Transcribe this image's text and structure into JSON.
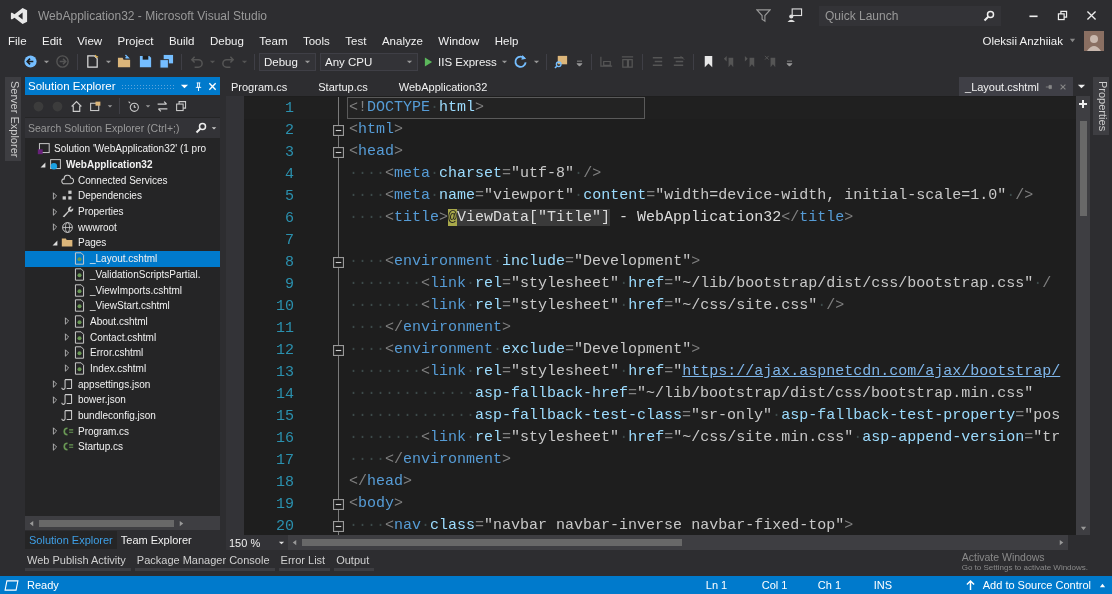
{
  "window": {
    "title": "WebApplication32 - Microsoft Visual Studio"
  },
  "quick_launch": {
    "placeholder": "Quick Launch"
  },
  "menu": [
    "File",
    "Edit",
    "View",
    "Project",
    "Build",
    "Debug",
    "Team",
    "Tools",
    "Test",
    "Analyze",
    "Window",
    "Help"
  ],
  "user": {
    "name": "Oleksii Anzhiiak"
  },
  "toolbar": {
    "configuration": "Debug",
    "platform": "Any CPU",
    "run": "IIS Express"
  },
  "side_tabs": {
    "left": "Server Explorer",
    "right": "Properties"
  },
  "solution_explorer": {
    "title": "Solution Explorer",
    "search": {
      "placeholder": "Search Solution Explorer (Ctrl+;)"
    },
    "tree": [
      {
        "label": "Solution 'WebApplication32' (1 pro",
        "kind": "solution",
        "selected": false,
        "children": [
          {
            "label": "WebApplication32",
            "kind": "project",
            "expanded": true,
            "selected": false,
            "children": [
              {
                "label": "Connected Services",
                "kind": "cloud",
                "selected": false
              },
              {
                "label": "Dependencies",
                "kind": "deps",
                "expanded": false,
                "selected": false
              },
              {
                "label": "Properties",
                "kind": "wrench",
                "expanded": false,
                "selected": false
              },
              {
                "label": "wwwroot",
                "kind": "globe",
                "expanded": false,
                "selected": false
              },
              {
                "label": "Pages",
                "kind": "folder",
                "expanded": true,
                "selected": false,
                "children": [
                  {
                    "label": "_Layout.cshtml",
                    "kind": "razor",
                    "selected": true
                  },
                  {
                    "label": "_ValidationScriptsPartial.",
                    "kind": "razor",
                    "selected": false
                  },
                  {
                    "label": "_ViewImports.cshtml",
                    "kind": "razor",
                    "selected": false
                  },
                  {
                    "label": "_ViewStart.cshtml",
                    "kind": "razor",
                    "selected": false
                  },
                  {
                    "label": "About.cshtml",
                    "kind": "razor",
                    "expanded": false,
                    "selected": false
                  },
                  {
                    "label": "Contact.cshtml",
                    "kind": "razor",
                    "expanded": false,
                    "selected": false
                  },
                  {
                    "label": "Error.cshtml",
                    "kind": "razor",
                    "expanded": false,
                    "selected": false
                  },
                  {
                    "label": "Index.cshtml",
                    "kind": "razor",
                    "expanded": false,
                    "selected": false
                  }
                ]
              },
              {
                "label": "appsettings.json",
                "kind": "json",
                "expanded": false,
                "selected": false
              },
              {
                "label": "bower.json",
                "kind": "json",
                "expanded": false,
                "selected": false
              },
              {
                "label": "bundleconfig.json",
                "kind": "json",
                "selected": false
              },
              {
                "label": "Program.cs",
                "kind": "cs",
                "expanded": false,
                "selected": false
              },
              {
                "label": "Startup.cs",
                "kind": "cs",
                "expanded": false,
                "selected": false
              }
            ]
          }
        ]
      }
    ],
    "tabs": [
      {
        "label": "Solution Explorer",
        "selected": true
      },
      {
        "label": "Team Explorer",
        "selected": false
      }
    ]
  },
  "editor": {
    "tabs": [
      {
        "label": "Program.cs",
        "selected": false
      },
      {
        "label": "Startup.cs",
        "selected": false
      },
      {
        "label": "WebApplication32",
        "selected": false
      },
      {
        "label": "_Layout.cshtml",
        "selected": true
      }
    ],
    "zoom": "150 %",
    "lines": [
      {
        "n": "1",
        "fold": false,
        "current": true,
        "tokens": [
          {
            "kind": "p",
            "text": "<!"
          },
          {
            "kind": "tag",
            "text": "DOCTYPE"
          },
          {
            "kind": "ws",
            "text": "·"
          },
          {
            "kind": "attr",
            "text": "html"
          },
          {
            "kind": "p",
            "text": ">"
          }
        ]
      },
      {
        "n": "2",
        "fold": true,
        "current": false,
        "tokens": [
          {
            "kind": "p",
            "text": "<"
          },
          {
            "kind": "tag",
            "text": "html"
          },
          {
            "kind": "p",
            "text": ">"
          }
        ]
      },
      {
        "n": "3",
        "fold": true,
        "current": false,
        "tokens": [
          {
            "kind": "p",
            "text": "<"
          },
          {
            "kind": "tag",
            "text": "head"
          },
          {
            "kind": "p",
            "text": ">"
          }
        ]
      },
      {
        "n": "4",
        "fold": false,
        "current": false,
        "tokens": [
          {
            "kind": "ws",
            "text": "····"
          },
          {
            "kind": "p",
            "text": "<"
          },
          {
            "kind": "tag",
            "text": "meta"
          },
          {
            "kind": "ws",
            "text": "·"
          },
          {
            "kind": "attr",
            "text": "charset"
          },
          {
            "kind": "p",
            "text": "="
          },
          {
            "kind": "str",
            "text": "\"utf-8\""
          },
          {
            "kind": "ws",
            "text": "·"
          },
          {
            "kind": "p",
            "text": "/>"
          }
        ]
      },
      {
        "n": "5",
        "fold": false,
        "current": false,
        "tokens": [
          {
            "kind": "ws",
            "text": "····"
          },
          {
            "kind": "p",
            "text": "<"
          },
          {
            "kind": "tag",
            "text": "meta"
          },
          {
            "kind": "ws",
            "text": "·"
          },
          {
            "kind": "attr",
            "text": "name"
          },
          {
            "kind": "p",
            "text": "="
          },
          {
            "kind": "str",
            "text": "\"viewport\""
          },
          {
            "kind": "ws",
            "text": "·"
          },
          {
            "kind": "attr",
            "text": "content"
          },
          {
            "kind": "p",
            "text": "="
          },
          {
            "kind": "str",
            "text": "\"width=device-width, initial-scale=1.0\""
          },
          {
            "kind": "ws",
            "text": "·"
          },
          {
            "kind": "p",
            "text": "/>"
          }
        ]
      },
      {
        "n": "6",
        "fold": false,
        "current": false,
        "tokens": [
          {
            "kind": "ws",
            "text": "····"
          },
          {
            "kind": "p",
            "text": "<"
          },
          {
            "kind": "tag",
            "text": "title"
          },
          {
            "kind": "p",
            "text": ">"
          },
          {
            "kind": "razor",
            "text": "@"
          },
          {
            "kind": "hl",
            "text": "ViewData[\"Title\"]"
          },
          {
            "kind": "text",
            "text": " - WebApplication32"
          },
          {
            "kind": "p",
            "text": "</"
          },
          {
            "kind": "tag",
            "text": "title"
          },
          {
            "kind": "p",
            "text": ">"
          }
        ]
      },
      {
        "n": "7",
        "fold": false,
        "current": false
      },
      {
        "n": "8",
        "fold": true,
        "current": false,
        "tokens": [
          {
            "kind": "ws",
            "text": "····"
          },
          {
            "kind": "p",
            "text": "<"
          },
          {
            "kind": "tag",
            "text": "environment"
          },
          {
            "kind": "ws",
            "text": "·"
          },
          {
            "kind": "attr",
            "text": "include"
          },
          {
            "kind": "p",
            "text": "="
          },
          {
            "kind": "str",
            "text": "\"Development\""
          },
          {
            "kind": "p",
            "text": ">"
          }
        ]
      },
      {
        "n": "9",
        "fold": false,
        "current": false,
        "tokens": [
          {
            "kind": "ws",
            "text": "········"
          },
          {
            "kind": "p",
            "text": "<"
          },
          {
            "kind": "tag",
            "text": "link"
          },
          {
            "kind": "ws",
            "text": "·"
          },
          {
            "kind": "attr",
            "text": "rel"
          },
          {
            "kind": "p",
            "text": "="
          },
          {
            "kind": "str",
            "text": "\"stylesheet\""
          },
          {
            "kind": "ws",
            "text": "·"
          },
          {
            "kind": "attr",
            "text": "href"
          },
          {
            "kind": "p",
            "text": "="
          },
          {
            "kind": "str",
            "text": "\"~/lib/bootstrap/dist/css/bootstrap.css\""
          },
          {
            "kind": "ws",
            "text": "·"
          },
          {
            "kind": "p",
            "text": "/"
          }
        ]
      },
      {
        "n": "10",
        "fold": false,
        "current": false,
        "tokens": [
          {
            "kind": "ws",
            "text": "········"
          },
          {
            "kind": "p",
            "text": "<"
          },
          {
            "kind": "tag",
            "text": "link"
          },
          {
            "kind": "ws",
            "text": "·"
          },
          {
            "kind": "attr",
            "text": "rel"
          },
          {
            "kind": "p",
            "text": "="
          },
          {
            "kind": "str",
            "text": "\"stylesheet\""
          },
          {
            "kind": "ws",
            "text": "·"
          },
          {
            "kind": "attr",
            "text": "href"
          },
          {
            "kind": "p",
            "text": "="
          },
          {
            "kind": "str",
            "text": "\"~/css/site.css\""
          },
          {
            "kind": "ws",
            "text": "·"
          },
          {
            "kind": "p",
            "text": "/>"
          }
        ]
      },
      {
        "n": "11",
        "fold": false,
        "current": false,
        "tokens": [
          {
            "kind": "ws",
            "text": "····"
          },
          {
            "kind": "p",
            "text": "</"
          },
          {
            "kind": "tag",
            "text": "environment"
          },
          {
            "kind": "p",
            "text": ">"
          }
        ]
      },
      {
        "n": "12",
        "fold": true,
        "current": false,
        "tokens": [
          {
            "kind": "ws",
            "text": "····"
          },
          {
            "kind": "p",
            "text": "<"
          },
          {
            "kind": "tag",
            "text": "environment"
          },
          {
            "kind": "ws",
            "text": "·"
          },
          {
            "kind": "attr",
            "text": "exclude"
          },
          {
            "kind": "p",
            "text": "="
          },
          {
            "kind": "str",
            "text": "\"Development\""
          },
          {
            "kind": "p",
            "text": ">"
          }
        ]
      },
      {
        "n": "13",
        "fold": false,
        "current": false,
        "tokens": [
          {
            "kind": "ws",
            "text": "········"
          },
          {
            "kind": "p",
            "text": "<"
          },
          {
            "kind": "tag",
            "text": "link"
          },
          {
            "kind": "ws",
            "text": "·"
          },
          {
            "kind": "attr",
            "text": "rel"
          },
          {
            "kind": "p",
            "text": "="
          },
          {
            "kind": "str",
            "text": "\"stylesheet\""
          },
          {
            "kind": "ws",
            "text": "·"
          },
          {
            "kind": "attr",
            "text": "href"
          },
          {
            "kind": "p",
            "text": "="
          },
          {
            "kind": "str",
            "text": "\""
          },
          {
            "kind": "link",
            "text": "https://ajax.aspnetcdn.com/ajax/bootstrap/"
          }
        ]
      },
      {
        "n": "14",
        "fold": false,
        "current": false,
        "tokens": [
          {
            "kind": "ws",
            "text": "··············"
          },
          {
            "kind": "attr",
            "text": "asp-fallback-href"
          },
          {
            "kind": "p",
            "text": "="
          },
          {
            "kind": "str",
            "text": "\"~/lib/bootstrap/dist/css/bootstrap.min.css\""
          }
        ]
      },
      {
        "n": "15",
        "fold": false,
        "current": false,
        "tokens": [
          {
            "kind": "ws",
            "text": "··············"
          },
          {
            "kind": "attr",
            "text": "asp-fallback-test-class"
          },
          {
            "kind": "p",
            "text": "="
          },
          {
            "kind": "str",
            "text": "\"sr-only\""
          },
          {
            "kind": "ws",
            "text": "·"
          },
          {
            "kind": "attr",
            "text": "asp-fallback-test-property"
          },
          {
            "kind": "p",
            "text": "="
          },
          {
            "kind": "str",
            "text": "\"pos"
          }
        ]
      },
      {
        "n": "16",
        "fold": false,
        "current": false,
        "tokens": [
          {
            "kind": "ws",
            "text": "········"
          },
          {
            "kind": "p",
            "text": "<"
          },
          {
            "kind": "tag",
            "text": "link"
          },
          {
            "kind": "ws",
            "text": "·"
          },
          {
            "kind": "attr",
            "text": "rel"
          },
          {
            "kind": "p",
            "text": "="
          },
          {
            "kind": "str",
            "text": "\"stylesheet\""
          },
          {
            "kind": "ws",
            "text": "·"
          },
          {
            "kind": "attr",
            "text": "href"
          },
          {
            "kind": "p",
            "text": "="
          },
          {
            "kind": "str",
            "text": "\"~/css/site.min.css\""
          },
          {
            "kind": "ws",
            "text": "·"
          },
          {
            "kind": "attr",
            "text": "asp-append-version"
          },
          {
            "kind": "p",
            "text": "="
          },
          {
            "kind": "str",
            "text": "\"tr"
          }
        ]
      },
      {
        "n": "17",
        "fold": false,
        "current": false,
        "tokens": [
          {
            "kind": "ws",
            "text": "····"
          },
          {
            "kind": "p",
            "text": "</"
          },
          {
            "kind": "tag",
            "text": "environment"
          },
          {
            "kind": "p",
            "text": ">"
          }
        ]
      },
      {
        "n": "18",
        "fold": false,
        "current": false,
        "tokens": [
          {
            "kind": "p",
            "text": "</"
          },
          {
            "kind": "tag",
            "text": "head"
          },
          {
            "kind": "p",
            "text": ">"
          }
        ]
      },
      {
        "n": "19",
        "fold": true,
        "current": false,
        "tokens": [
          {
            "kind": "p",
            "text": "<"
          },
          {
            "kind": "tag",
            "text": "body"
          },
          {
            "kind": "p",
            "text": ">"
          }
        ]
      },
      {
        "n": "20",
        "fold": true,
        "current": false,
        "tokens": [
          {
            "kind": "ws",
            "text": "····"
          },
          {
            "kind": "p",
            "text": "<"
          },
          {
            "kind": "tag",
            "text": "nav"
          },
          {
            "kind": "ws",
            "text": "·"
          },
          {
            "kind": "attr",
            "text": "class"
          },
          {
            "kind": "p",
            "text": "="
          },
          {
            "kind": "str",
            "text": "\"navbar navbar-inverse navbar-fixed-top\""
          },
          {
            "kind": "p",
            "text": ">"
          }
        ]
      }
    ]
  },
  "tool_tabs": [
    "Web Publish Activity",
    "Package Manager Console",
    "Error List",
    "Output"
  ],
  "activation": {
    "title": "Activate Windows",
    "text": "Go to Settings to activate Windows."
  },
  "status_bar": {
    "state": "Ready",
    "ln": "Ln 1",
    "col": "Col 1",
    "ch": "Ch 1",
    "mode": "INS",
    "source_control": "Add to Source Control"
  }
}
